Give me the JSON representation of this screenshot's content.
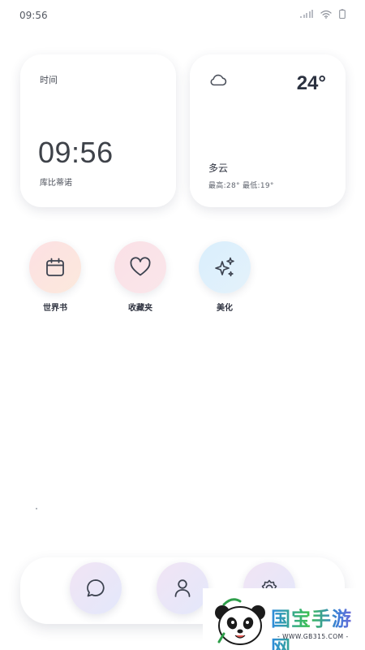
{
  "status_bar": {
    "time": "09:56",
    "icons": [
      "signal-icon",
      "wifi-icon",
      "battery-icon"
    ]
  },
  "time_widget": {
    "label": "时间",
    "clock": "09:56",
    "subtitle": "库比蒂诺"
  },
  "weather_widget": {
    "icon": "cloud-icon",
    "temperature": "24°",
    "condition": "多云",
    "range": "最高:28° 最低:19°"
  },
  "apps": [
    {
      "label": "世界书",
      "icon": "calendar-icon"
    },
    {
      "label": "收藏夹",
      "icon": "heart-icon"
    },
    {
      "label": "美化",
      "icon": "sparkles-icon"
    }
  ],
  "dock": [
    {
      "icon": "chat-bubble-icon"
    },
    {
      "icon": "person-icon"
    },
    {
      "icon": "gear-icon"
    }
  ],
  "watermark": {
    "brand": "国宝手游网",
    "url": "- WWW.GB315.COM -"
  },
  "colors": {
    "text_primary": "#2f3340",
    "icon_stroke": "#3d4350",
    "book_tint": "#fde0e3",
    "fav_tint": "#fbe0e6",
    "beauty_tint": "#d9eefc",
    "dock_tint": "#e3e8fb"
  }
}
